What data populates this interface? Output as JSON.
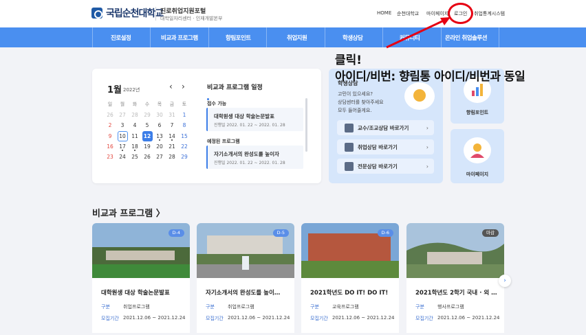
{
  "header": {
    "logo_text": "국립순천대학교",
    "portal_title": "진로취업지원포털",
    "portal_sub": "대학일자리센터 · 인재개발본부",
    "nav": [
      "HOME",
      "순천대학교",
      "마이페이지",
      "로그인",
      "취업통계시스템"
    ]
  },
  "menu": [
    "진로설정",
    "비교과 프로그램",
    "향림포인트",
    "취업지원",
    "학생상담",
    "커뮤니티",
    "온라인 취업솔루션"
  ],
  "annotation": {
    "click": "클릭!",
    "idpw": "아이디/비번: 향림통 아이디/비번과 동일",
    "color": "#e60012"
  },
  "calendar": {
    "month": "1월",
    "year": "2022년",
    "prev": "‹",
    "next": "›",
    "weekdays": [
      "일",
      "월",
      "화",
      "수",
      "목",
      "금",
      "토"
    ],
    "weeks": [
      [
        "26",
        "27",
        "28",
        "29",
        "30",
        "31",
        "1"
      ],
      [
        "2",
        "3",
        "4",
        "5",
        "6",
        "7",
        "8"
      ],
      [
        "9",
        "10",
        "11",
        "12",
        "13",
        "14",
        "15"
      ],
      [
        "16",
        "17",
        "18",
        "19",
        "20",
        "21",
        "22"
      ],
      [
        "23",
        "24",
        "25",
        "26",
        "27",
        "28",
        "29"
      ]
    ],
    "today": "10",
    "selected": "12"
  },
  "schedule": {
    "title": "비교과 프로그램 일정",
    "open_label": "접수 가능",
    "open_item": {
      "title": "대학원생 대상 학술논문발표",
      "date": "진행일 2022. 01. 22 ~ 2022. 01. 28"
    },
    "upcoming_label": "예정된 프로그램",
    "upcoming_item": {
      "title": "자기소개서의 완성도를 높이자",
      "date": "진행일 2022. 01. 22 ~ 2022. 01. 28"
    }
  },
  "counsel": {
    "title": "학생상담",
    "desc": [
      "고민이 있으세요?",
      "상담센터를 찾아주세요",
      "모두 들어줄게요."
    ],
    "buttons": [
      "교수/조교상담 바로가기",
      "취업상담 바로가기",
      "전문상담 바로가기"
    ]
  },
  "tiles": [
    "향림포인트",
    "마이페이지"
  ],
  "programs": {
    "title": "비교과 프로그램 〉",
    "key_type": "구분",
    "key_period": "모집기간",
    "cards": [
      {
        "badge": "D-4",
        "title": "대학원생 대상 학술논문발표",
        "type": "취업프로그램",
        "period": "2021.12.06 ~ 2021.12.24"
      },
      {
        "badge": "D-5",
        "title": "자기소개서의 완성도를 높이…",
        "type": "취업프로그램",
        "period": "2021.12.06 ~ 2021.12.24"
      },
      {
        "badge": "D-6",
        "title": "2021학년도 DO IT! DO IT!",
        "type": "교육프로그램",
        "period": "2021.12.06 ~ 2021.12.24"
      },
      {
        "badge": "마감",
        "title": "2021학년도 2학기 국내 · 외 …",
        "type": "행사프로그램",
        "period": "2021.12.06 ~ 2021.12.24"
      }
    ],
    "next": "›"
  }
}
